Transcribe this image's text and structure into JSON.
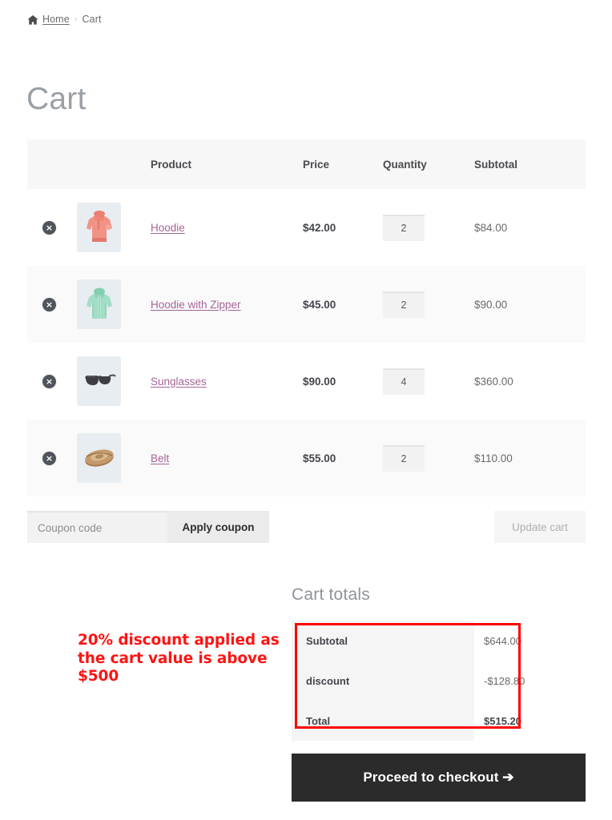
{
  "breadcrumb": {
    "home_icon": "home-icon",
    "home_label": "Home",
    "separator": "›",
    "current": "Cart"
  },
  "page": {
    "title": "Cart"
  },
  "cart_table": {
    "headers": {
      "remove": "",
      "thumbnail": "",
      "product": "Product",
      "price": "Price",
      "quantity": "Quantity",
      "subtotal": "Subtotal"
    },
    "remove_icon": "remove-circle-x-icon",
    "rows": [
      {
        "remove": "×",
        "thumb_alt": "hoodie-thumbnail",
        "name": "Hoodie",
        "price": "$42.00",
        "quantity": "2",
        "subtotal": "$84.00"
      },
      {
        "remove": "×",
        "thumb_alt": "hoodie-with-zipper-thumbnail",
        "name": "Hoodie with Zipper",
        "price": "$45.00",
        "quantity": "2",
        "subtotal": "$90.00"
      },
      {
        "remove": "×",
        "thumb_alt": "sunglasses-thumbnail",
        "name": "Sunglasses",
        "price": "$90.00",
        "quantity": "4",
        "subtotal": "$360.00"
      },
      {
        "remove": "×",
        "thumb_alt": "belt-thumbnail",
        "name": "Belt",
        "price": "$55.00",
        "quantity": "2",
        "subtotal": "$110.00"
      }
    ]
  },
  "coupon": {
    "placeholder": "Coupon code",
    "value": "",
    "apply_label": "Apply coupon",
    "update_cart_label": "Update cart"
  },
  "totals": {
    "heading": "Cart totals",
    "rows": [
      {
        "label": "Subtotal",
        "value": "$644.00"
      },
      {
        "label": "discount",
        "value": "-$128.80"
      },
      {
        "label": "Total",
        "value": "$515.20"
      }
    ]
  },
  "checkout": {
    "label": "Proceed to checkout  ➔"
  },
  "annotation": {
    "text": "20% discount applied as the cart value is above $500",
    "color": "#ff1313",
    "box_color": "#ff0000"
  }
}
